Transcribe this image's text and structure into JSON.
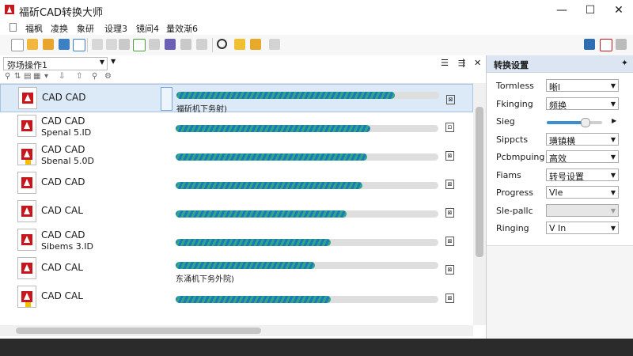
{
  "window": {
    "title": "福斫CAD转换大师",
    "minimize": "—",
    "maximize": "☐",
    "close": "✕"
  },
  "menu": [
    "福枫",
    "凌换",
    "象研",
    "设理3",
    "镜间4",
    "量效渐6"
  ],
  "left_pane": {
    "combo_value": "弥场操作1",
    "menu_icon": "☰",
    "pin_icon": "⇶",
    "close_icon": "✕",
    "rows": [
      {
        "name": "CAD CAD",
        "sub": "",
        "progress": 0.83,
        "label": "福斫机下务射)",
        "selected": true,
        "badge": false,
        "action": "⊠"
      },
      {
        "name": "CAD CAD",
        "sub": "Spenal 5.ID",
        "progress": 0.74,
        "label": "",
        "selected": false,
        "badge": false,
        "action": "⊡"
      },
      {
        "name": "CAD CAD",
        "sub": "Sbenal 5.0D",
        "progress": 0.73,
        "label": "",
        "selected": false,
        "badge": true,
        "action": "⊠"
      },
      {
        "name": "CAD CAD",
        "sub": "",
        "progress": 0.71,
        "label": "",
        "selected": false,
        "badge": false,
        "action": "⊠"
      },
      {
        "name": "CAD CAL",
        "sub": "",
        "progress": 0.65,
        "label": "",
        "selected": false,
        "badge": false,
        "action": "⊠"
      },
      {
        "name": "CAD CAD",
        "sub": "Sibems 3.ID",
        "progress": 0.59,
        "label": "",
        "selected": false,
        "badge": false,
        "action": "⊠"
      },
      {
        "name": "CAD CAL",
        "sub": "",
        "progress": 0.53,
        "label": "东涌机下务外院)",
        "selected": false,
        "badge": false,
        "action": "⊠"
      },
      {
        "name": "CAD CAL",
        "sub": "",
        "progress": 0.59,
        "label": "",
        "selected": false,
        "badge": true,
        "action": "⊠"
      }
    ]
  },
  "right_pane": {
    "title": "转换设置",
    "pin": "✦",
    "props": [
      {
        "label": "Tormless",
        "value": "晰l",
        "type": "select"
      },
      {
        "label": "Fkinging",
        "value": "频换",
        "type": "select"
      },
      {
        "label": "Sieg",
        "value": "",
        "type": "slider",
        "level": 0.68
      },
      {
        "label": "Sippcts",
        "value": "璜镇横",
        "type": "select"
      },
      {
        "label": "Pcbmpuing",
        "value": "高效",
        "type": "select"
      },
      {
        "label": "Fiams",
        "value": "转号设置",
        "type": "select"
      },
      {
        "label": "Progress",
        "value": "Vle",
        "type": "select"
      },
      {
        "label": "Sle-pallc",
        "value": "",
        "type": "select",
        "disabled": true
      },
      {
        "label": "Ringing",
        "value": "V In",
        "type": "select"
      }
    ]
  },
  "colors": {
    "accent": "#1e78b8",
    "progress_green": "#2fa88a",
    "brand_red": "#c8161d",
    "panel_header": "#dbe6f2"
  }
}
